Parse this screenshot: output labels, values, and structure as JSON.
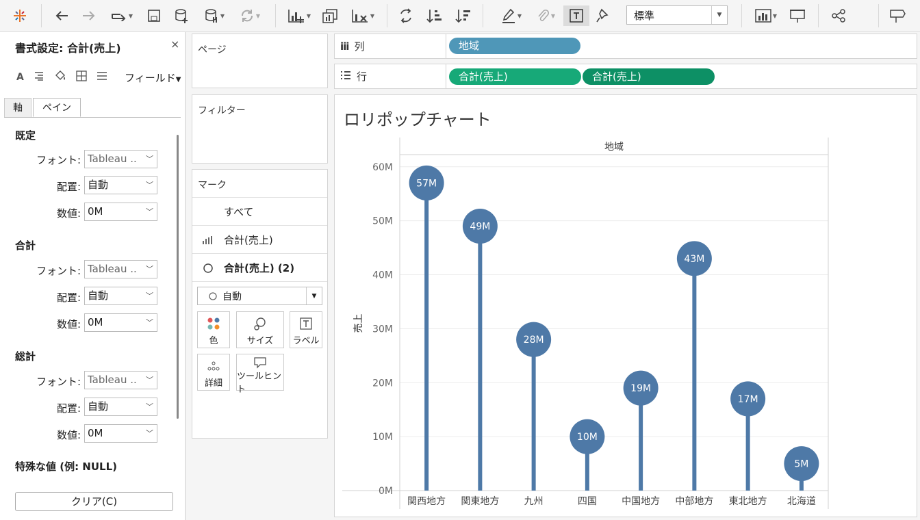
{
  "toolbar": {
    "items": [
      "tableau-logo-icon",
      "undo-icon",
      "redo-icon",
      "replay-icon",
      "save-icon",
      "new-datasource-icon",
      "pause-icon",
      "refresh-icon",
      "new-sheet-icon",
      "duplicate-sheet-icon",
      "clear-sheet-icon",
      "swap-icon",
      "sort-asc-icon",
      "sort-desc-icon",
      "highlight-icon",
      "attach-icon",
      "label-icon",
      "pin-icon",
      "show-me-icon",
      "presentation-icon",
      "share-icon",
      "comment-icon"
    ],
    "fit_value": "標準"
  },
  "format_panel": {
    "title": "書式設定: 合計(売上)",
    "close": "×",
    "icons": [
      "font-a-icon",
      "alignment-icon",
      "shading-icon",
      "borders-icon",
      "lines-icon"
    ],
    "field_label": "フィールド",
    "tabs": {
      "axis": "軸",
      "pane": "ペイン"
    },
    "sections": [
      {
        "title": "既定",
        "font_label": "フォント:",
        "font_value": "Tableau ..",
        "align_label": "配置:",
        "align_value": "自動",
        "number_label": "数値:",
        "number_value": "0M"
      },
      {
        "title": "合計",
        "font_label": "フォント:",
        "font_value": "Tableau ..",
        "align_label": "配置:",
        "align_value": "自動",
        "number_label": "数値:",
        "number_value": "0M"
      },
      {
        "title": "総計",
        "font_label": "フォント:",
        "font_value": "Tableau ..",
        "align_label": "配置:",
        "align_value": "自動",
        "number_label": "数値:",
        "number_value": "0M"
      }
    ],
    "special_values": "特殊な値 (例: NULL)",
    "clear_button": "クリア(C)"
  },
  "pages_card": {
    "title": "ページ"
  },
  "filters_card": {
    "title": "フィルター"
  },
  "marks_card": {
    "title": "マーク",
    "rows": [
      {
        "label": "すべて"
      },
      {
        "label": "合計(売上)"
      },
      {
        "label": "合計(売上) (2)"
      }
    ],
    "mark_type": "自動",
    "buttons": {
      "color": "色",
      "size": "サイズ",
      "label": "ラベル",
      "detail": "詳細",
      "tooltip": "ツールヒント"
    }
  },
  "columns_shelf": {
    "label": "列",
    "pills": [
      "地域"
    ],
    "pill_color": "#4f97b8"
  },
  "rows_shelf": {
    "label": "行",
    "pills": [
      "合計(売上)",
      "合計(売上)"
    ],
    "pill_colors": [
      "#17a978",
      "#0d9065"
    ]
  },
  "chart_data": {
    "type": "lollipop",
    "title": "ロリポップチャート",
    "header": "地域",
    "ylabel": "売上",
    "categories": [
      "関西地方",
      "関東地方",
      "九州",
      "四国",
      "中国地方",
      "中部地方",
      "東北地方",
      "北海道"
    ],
    "values": [
      57,
      49,
      28,
      10,
      19,
      43,
      17,
      5
    ],
    "value_labels": [
      "57M",
      "49M",
      "28M",
      "10M",
      "19M",
      "43M",
      "17M",
      "5M"
    ],
    "unit": "M",
    "ylim": [
      0,
      62
    ],
    "yticks": [
      0,
      10,
      20,
      30,
      40,
      50,
      60
    ],
    "ytick_labels": [
      "0M",
      "10M",
      "20M",
      "30M",
      "40M",
      "50M",
      "60M"
    ],
    "mark_color": "#4e79a7",
    "grid": true
  }
}
